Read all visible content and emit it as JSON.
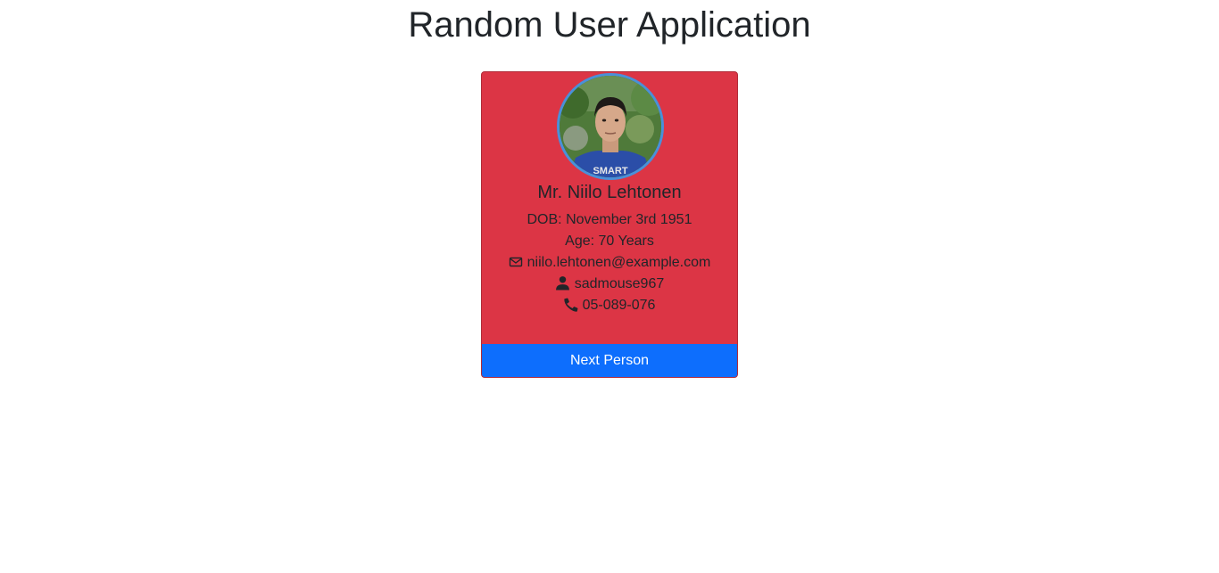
{
  "page": {
    "title": "Random User Application"
  },
  "user": {
    "name": "Mr. Niilo Lehtonen",
    "dob": "DOB: November 3rd 1951",
    "age": "Age: 70 Years",
    "email": "niilo.lehtonen@example.com",
    "username": "sadmouse967",
    "phone": "05-089-076",
    "shirt_text": "SMART"
  },
  "card": {
    "next_button_label": "Next Person"
  },
  "icons": {
    "email": "envelope-icon",
    "username": "person-icon",
    "phone": "phone-icon"
  },
  "colors": {
    "card_background": "#dc3545",
    "button_background": "#0d6efd",
    "avatar_border": "#4a90d9"
  }
}
